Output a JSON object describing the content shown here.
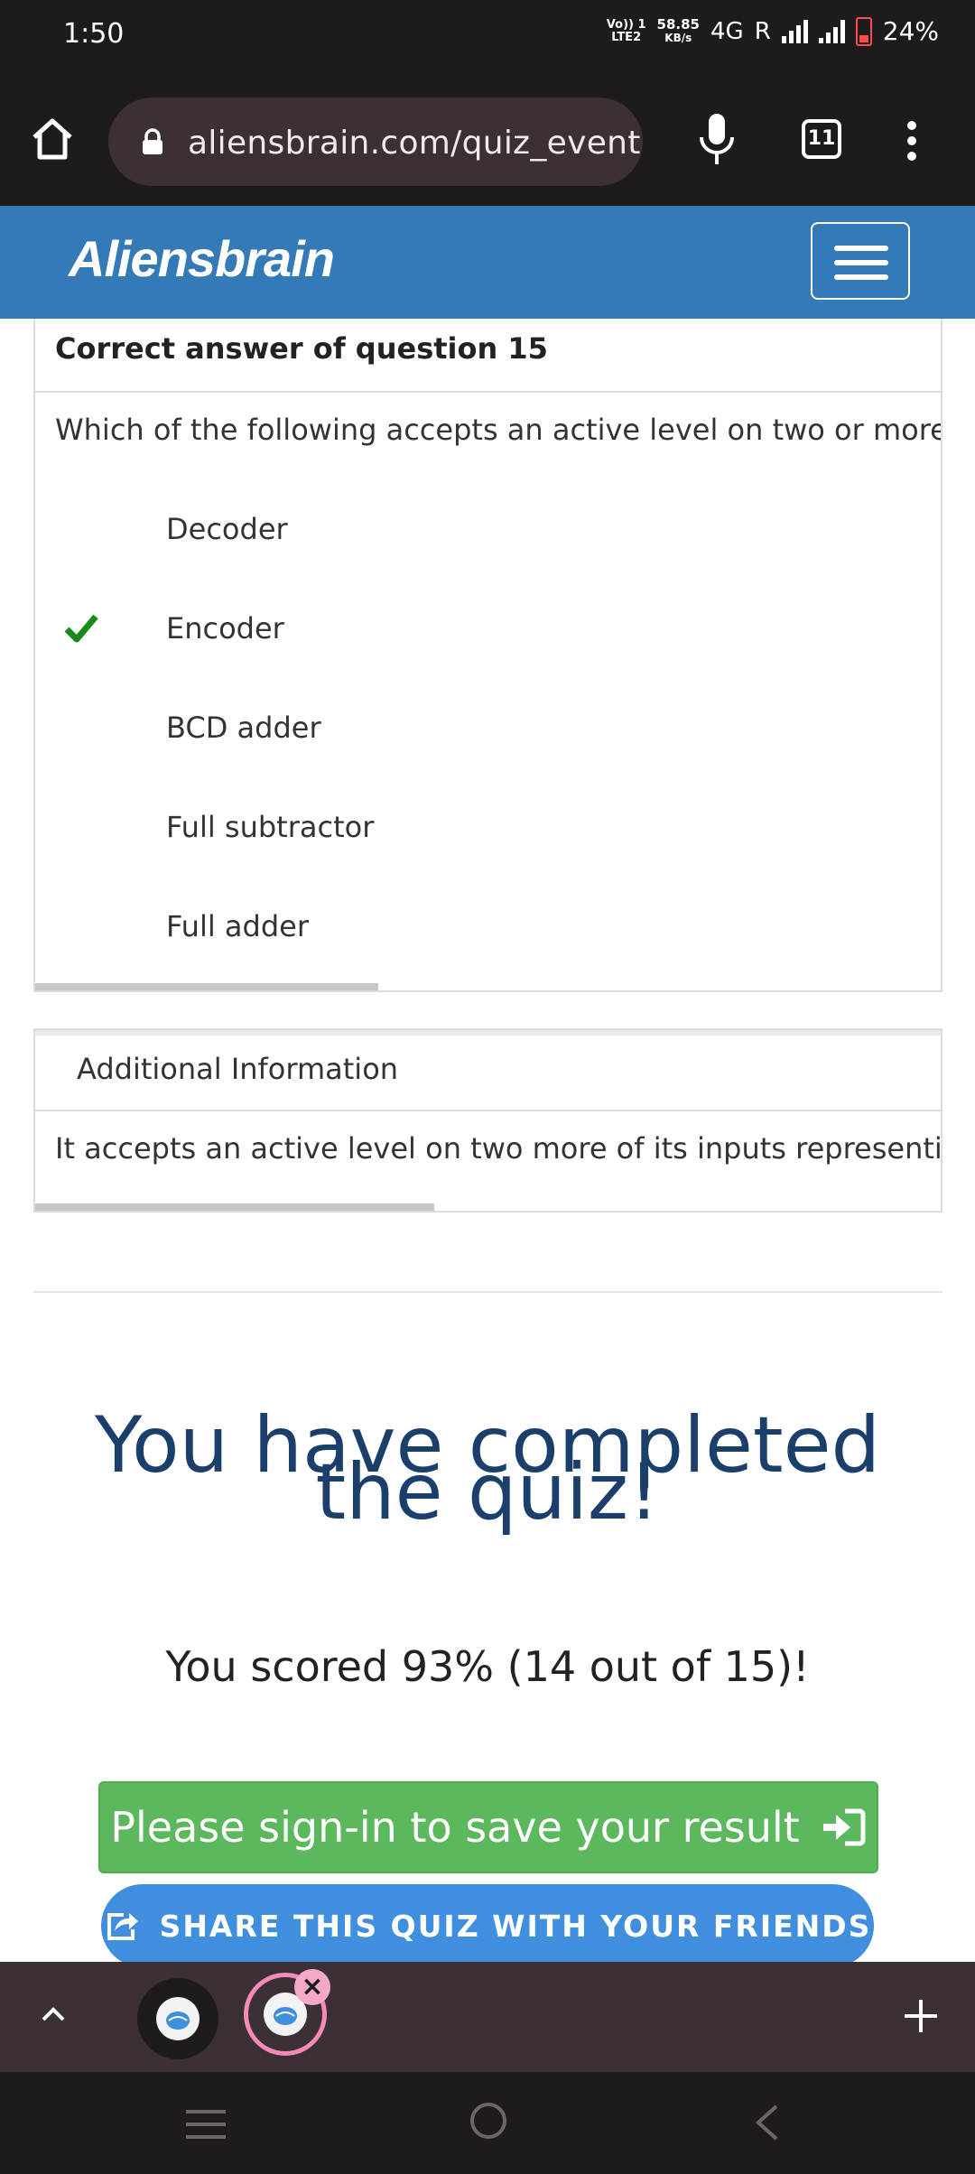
{
  "status_bar": {
    "time": "1:50",
    "volte_line1": "Vo)) 1",
    "volte_line2": "LTE2",
    "speed_value": "58.85",
    "speed_unit": "KB/s",
    "network": "4G",
    "roaming": "R",
    "battery_percent": "24%"
  },
  "browser": {
    "url": "aliensbrain.com/quiz_event",
    "tab_count": "11"
  },
  "site": {
    "brand": "Aliensbrain"
  },
  "question_card": {
    "title": "Correct answer of question 15",
    "question": "Which of the following accepts an active level on two or more of its",
    "options": [
      {
        "label": "Decoder",
        "correct": false
      },
      {
        "label": "Encoder",
        "correct": true
      },
      {
        "label": "BCD adder",
        "correct": false
      },
      {
        "label": "Full subtractor",
        "correct": false
      },
      {
        "label": "Full adder",
        "correct": false
      }
    ]
  },
  "additional_info": {
    "title": "Additional Information",
    "text": "It accepts an active level on two more of its inputs representing di"
  },
  "result": {
    "title": "You have completed the quiz!",
    "score_text": "You scored 93% (14 out of 15)!"
  },
  "actions": {
    "signin_label": "Please sign-in to save your result",
    "share_label": "SHARE THIS QUIZ WITH YOUR FRIENDS"
  },
  "colors": {
    "header_blue": "#337ab7",
    "signin_green": "#5cb85c",
    "share_blue": "#3f8fde",
    "check_green": "#1a8a1a",
    "result_title": "#1b3f6b"
  }
}
